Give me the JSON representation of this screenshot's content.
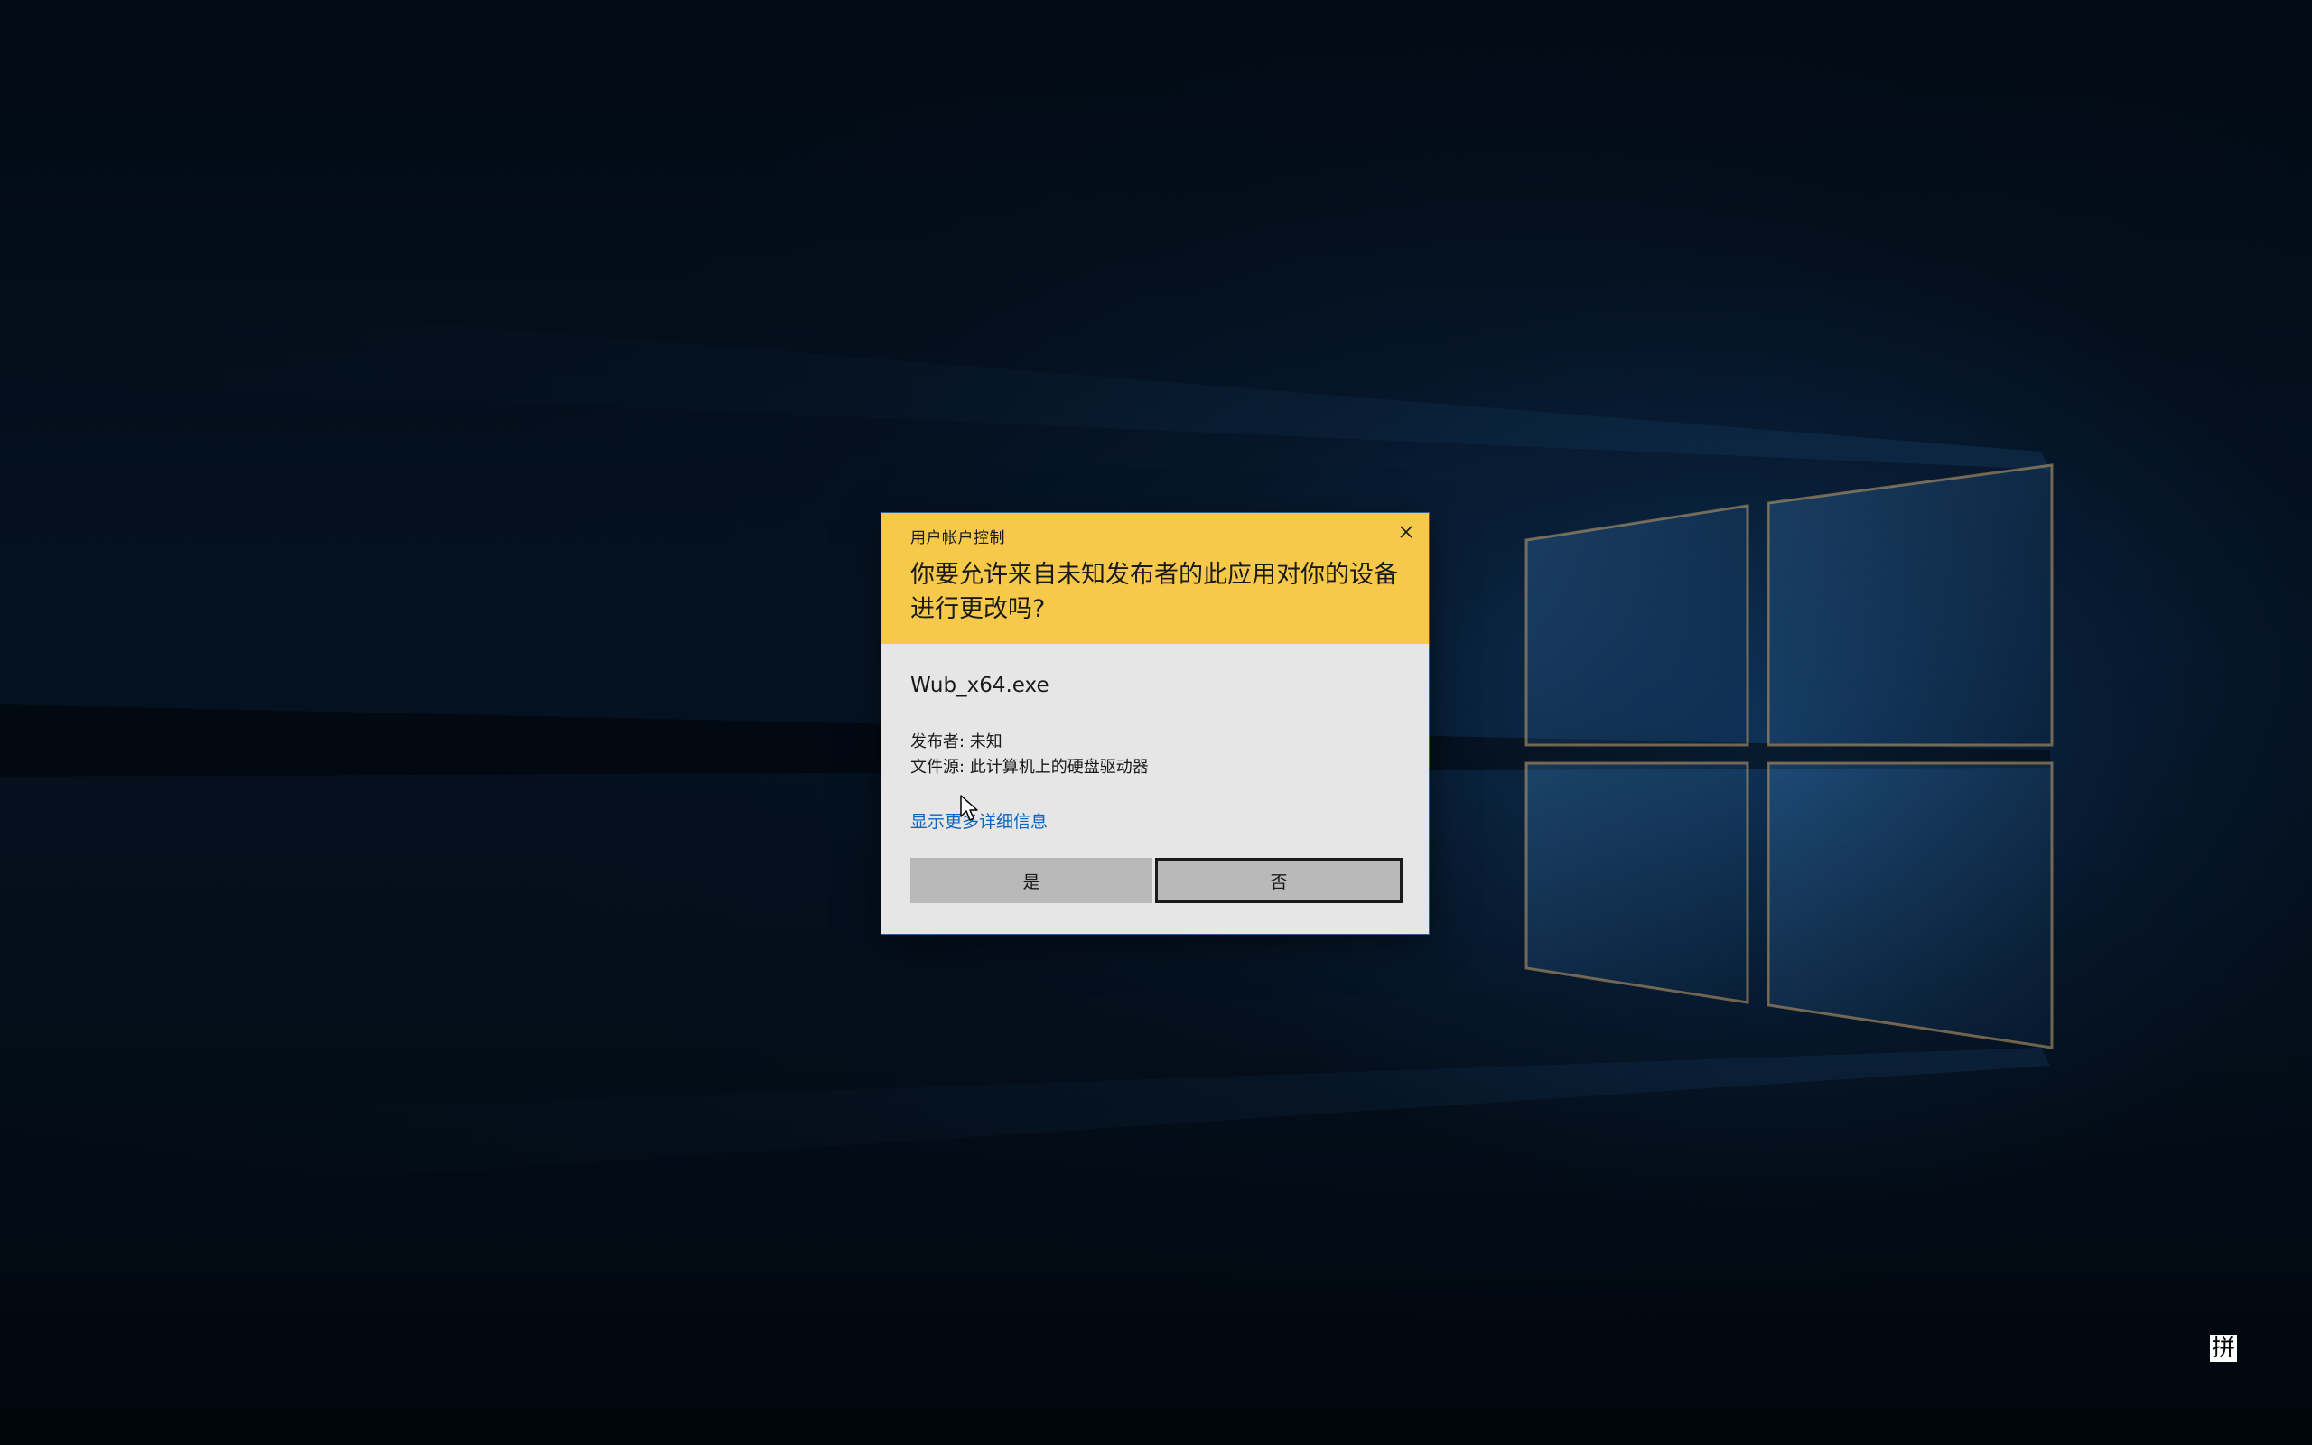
{
  "desktop": {
    "colors": {
      "background": "#030d18",
      "window_glow": "#2f6fa8"
    }
  },
  "uac_dialog": {
    "window_title": "用户帐户控制",
    "question": "你要允许来自未知发布者的此应用对你的设备进行更改吗?",
    "app_name": "Wub_x64.exe",
    "publisher_label": "发布者: 未知",
    "file_origin_label": "文件源: 此计算机上的硬盘驱动器",
    "more_details_link": "显示更多详细信息",
    "yes_button": "是",
    "no_button": "否",
    "close_icon": "close-icon",
    "colors": {
      "header": "#f6c94b",
      "body": "#e6e6e6",
      "button": "#b9b9b9",
      "link": "#0a66c2"
    }
  },
  "taskbar_tray": {
    "ime_indicator": "拼"
  }
}
